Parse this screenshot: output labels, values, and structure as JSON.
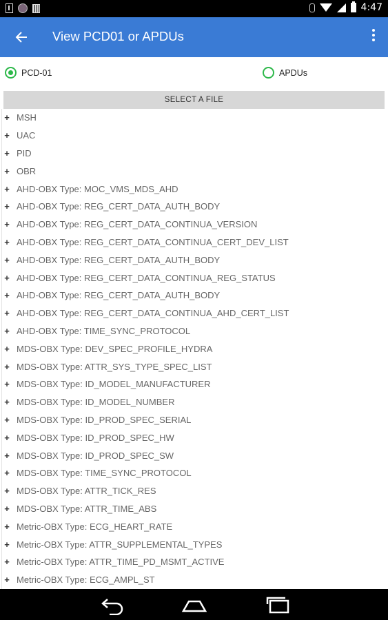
{
  "status_bar": {
    "time": "4:47",
    "icons": [
      "notification-icon",
      "app-avatar-icon",
      "barcode-icon",
      "bluetooth-icon",
      "wifi-icon",
      "signal-icon",
      "battery-icon"
    ]
  },
  "app_bar": {
    "title": "View PCD01 or APDUs",
    "color": "#3a7bd5"
  },
  "radio_options": [
    {
      "label": "PCD-01",
      "checked": true
    },
    {
      "label": "APDUs",
      "checked": false
    }
  ],
  "accent_color": "#2db84a",
  "select_button_label": "SELECT A FILE",
  "tree_items": [
    {
      "expander": "+",
      "label": "MSH"
    },
    {
      "expander": "+",
      "label": "UAC"
    },
    {
      "expander": "+",
      "label": "PID"
    },
    {
      "expander": "+",
      "label": "OBR"
    },
    {
      "expander": "+",
      "label": "AHD-OBX Type: MOC_VMS_MDS_AHD"
    },
    {
      "expander": "+",
      "label": "AHD-OBX Type: REG_CERT_DATA_AUTH_BODY"
    },
    {
      "expander": "+",
      "label": "AHD-OBX Type: REG_CERT_DATA_CONTINUA_VERSION"
    },
    {
      "expander": "+",
      "label": "AHD-OBX Type: REG_CERT_DATA_CONTINUA_CERT_DEV_LIST"
    },
    {
      "expander": "+",
      "label": "AHD-OBX Type: REG_CERT_DATA_AUTH_BODY"
    },
    {
      "expander": "+",
      "label": "AHD-OBX Type: REG_CERT_DATA_CONTINUA_REG_STATUS"
    },
    {
      "expander": "+",
      "label": "AHD-OBX Type: REG_CERT_DATA_AUTH_BODY"
    },
    {
      "expander": "+",
      "label": "AHD-OBX Type: REG_CERT_DATA_CONTINUA_AHD_CERT_LIST"
    },
    {
      "expander": "+",
      "label": "AHD-OBX Type: TIME_SYNC_PROTOCOL"
    },
    {
      "expander": "+",
      "label": "MDS-OBX Type: DEV_SPEC_PROFILE_HYDRA"
    },
    {
      "expander": "+",
      "label": "MDS-OBX Type: ATTR_SYS_TYPE_SPEC_LIST"
    },
    {
      "expander": "+",
      "label": "MDS-OBX Type: ID_MODEL_MANUFACTURER"
    },
    {
      "expander": "+",
      "label": "MDS-OBX Type: ID_MODEL_NUMBER"
    },
    {
      "expander": "+",
      "label": "MDS-OBX Type: ID_PROD_SPEC_SERIAL"
    },
    {
      "expander": "+",
      "label": "MDS-OBX Type: ID_PROD_SPEC_HW"
    },
    {
      "expander": "+",
      "label": "MDS-OBX Type: ID_PROD_SPEC_SW"
    },
    {
      "expander": "+",
      "label": "MDS-OBX Type: TIME_SYNC_PROTOCOL"
    },
    {
      "expander": "+",
      "label": "MDS-OBX Type: ATTR_TICK_RES"
    },
    {
      "expander": "+",
      "label": "MDS-OBX Type: ATTR_TIME_ABS"
    },
    {
      "expander": "+",
      "label": "Metric-OBX Type: ECG_HEART_RATE"
    },
    {
      "expander": "+",
      "label": "Metric-OBX Type: ATTR_SUPPLEMENTAL_TYPES"
    },
    {
      "expander": "+",
      "label": "Metric-OBX Type: ATTR_TIME_PD_MSMT_ACTIVE"
    },
    {
      "expander": "+",
      "label": "Metric-OBX Type: ECG_AMPL_ST"
    }
  ]
}
